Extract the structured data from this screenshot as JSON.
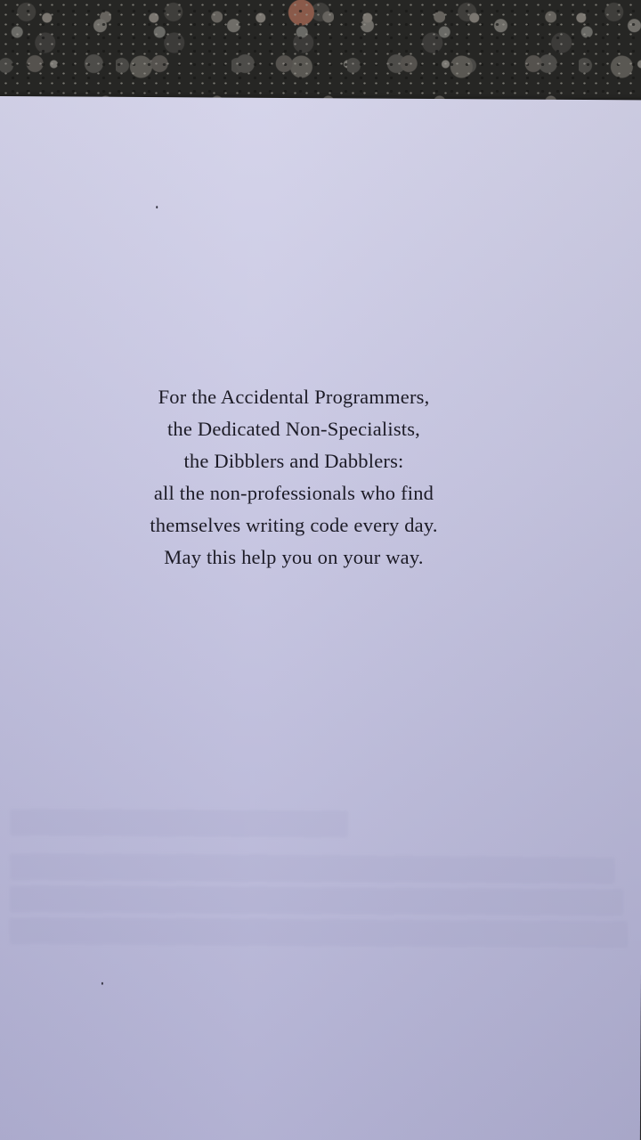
{
  "dedication": {
    "lines": [
      "For the Accidental Programmers,",
      "the Dedicated Non-Specialists,",
      "the Dibblers and Dabblers:",
      "all the non-professionals who find",
      "themselves writing code every day.",
      "May this help you on your way."
    ]
  },
  "colors": {
    "paper": "#c7c6e2",
    "ink": "#1c1b26",
    "background": "#262624"
  }
}
